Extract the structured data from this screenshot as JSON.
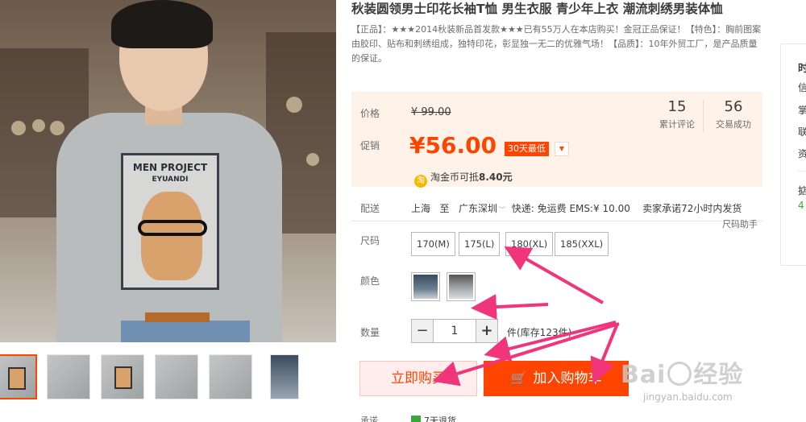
{
  "product": {
    "title": "秋装圆领男士印花长袖T恤 男生衣服 青少年上衣 潮流刺绣男装体恤",
    "subtitle": "【正品】：★★★2014秋装新品首发款★★★已有55万人在本店购买！金冠正品保证！【特色】：胸前图案由胶印、贴布和刺绣组成，独特印花，彰显独一无二的优雅气场！【品质】：10年外贸工厂，是产品质量的保证。",
    "print_title": "MEN PROJECT",
    "print_sub": "EYUANDI"
  },
  "price": {
    "label": "价格",
    "original": "¥ 99.00",
    "promo_label": "促销",
    "promo": "¥56.00",
    "badge": "30天最低",
    "badge_dropdown": "▼",
    "reviews_count": "15",
    "reviews_label": "累计评论",
    "trades_count": "56",
    "trades_label": "交易成功",
    "coin_icon": "淘",
    "coin_text": "淘金币可抵",
    "coin_amount": "8.40元"
  },
  "shipping": {
    "label": "配送",
    "from": "上海",
    "to_word": "至",
    "dest": "广东深圳",
    "fee": "快递: 免运费 EMS:¥ 10.00",
    "promise": "卖家承诺72小时内发货",
    "size_helper": "尺码助手"
  },
  "size": {
    "label": "尺码",
    "options": [
      "170(M)",
      "175(L)",
      "180(XL)",
      "185(XXL)"
    ]
  },
  "color": {
    "label": "颜色"
  },
  "quantity": {
    "label": "数量",
    "minus": "−",
    "value": "1",
    "plus": "+",
    "stock": "件(库存123件)"
  },
  "actions": {
    "buy_now": "立即购买",
    "add_cart": "加入购物车",
    "cart_icon": "🛒"
  },
  "promise": {
    "label": "承诺",
    "badge": "7天退货"
  },
  "side_panel": {
    "chars": [
      "时",
      "信",
      "掌",
      "联",
      "资",
      "掂",
      "4"
    ]
  },
  "watermark": {
    "main_left": "Bai",
    "main_right": "经验",
    "sub": "jingyan.baidu.com"
  },
  "colors": {
    "accent": "#ff4400",
    "price_bg": "#fff2e8",
    "arrow": "#f0357a"
  }
}
